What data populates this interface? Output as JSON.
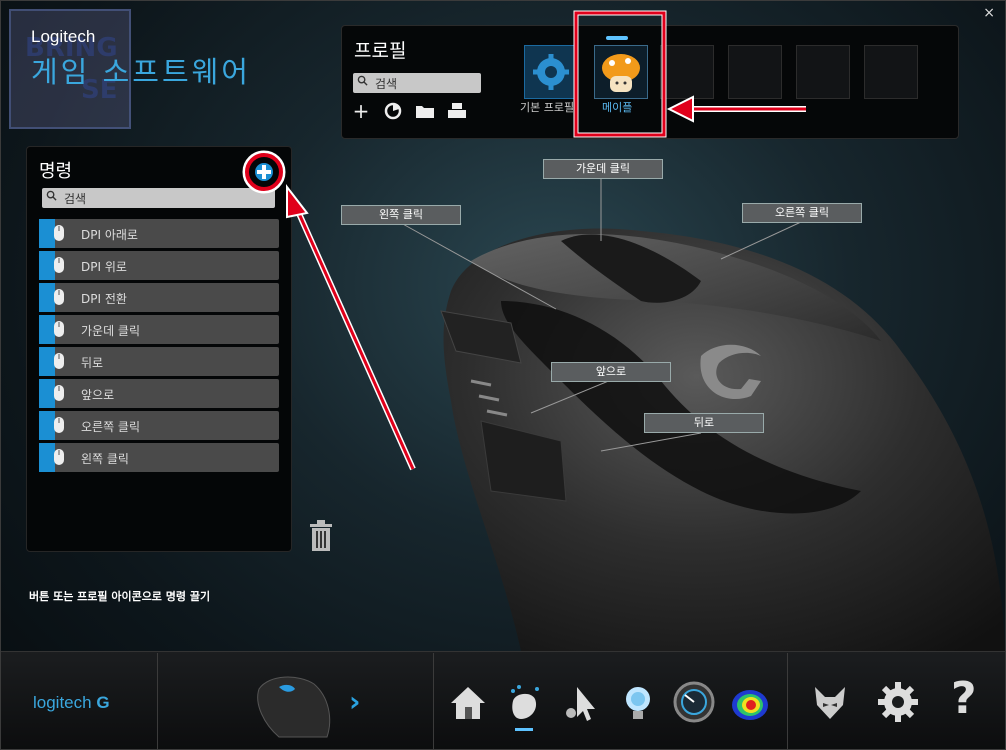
{
  "window": {
    "close_label": "×"
  },
  "brand": {
    "top": "Logitech",
    "title": "게임 소프트웨어",
    "watermark_top": "BRING",
    "watermark_bottom": "SE"
  },
  "profile": {
    "title": "프로필",
    "search_placeholder": "검색",
    "tools": [
      "add-icon",
      "clock-icon",
      "folder-icon",
      "printer-icon"
    ],
    "slots": [
      {
        "label": "기본 프로필",
        "icon": "gear-icon"
      },
      {
        "label": "메이플",
        "icon": "mushroom-icon",
        "selected": true
      }
    ]
  },
  "commands": {
    "title": "명령",
    "search_placeholder": "검색",
    "items": [
      "DPI 아래로",
      "DPI 위로",
      "DPI 전환",
      "가운데 클릭",
      "뒤로",
      "앞으로",
      "오른쪽 클릭",
      "왼쪽 클릭"
    ],
    "hint": "버튼 또는 프로필 아이콘으로 명령 끌기"
  },
  "mouse_labels": {
    "middle": "가운데 클릭",
    "left": "왼쪽 클릭",
    "right": "오른쪽 클릭",
    "forward": "앞으로",
    "back": "뒤로"
  },
  "bottom": {
    "logo": "logitech",
    "icons": [
      "mouse-thumbnail-icon",
      "next-chevron-icon",
      "home-icon",
      "customize-buttons-icon",
      "pointer-settings-icon",
      "lighting-icon",
      "dpi-gauge-icon",
      "heatmap-icon",
      "gaming-mode-icon",
      "settings-gear-icon",
      "help-icon"
    ]
  },
  "colors": {
    "accent": "#3aa7de",
    "annotation": "#e0001b"
  }
}
